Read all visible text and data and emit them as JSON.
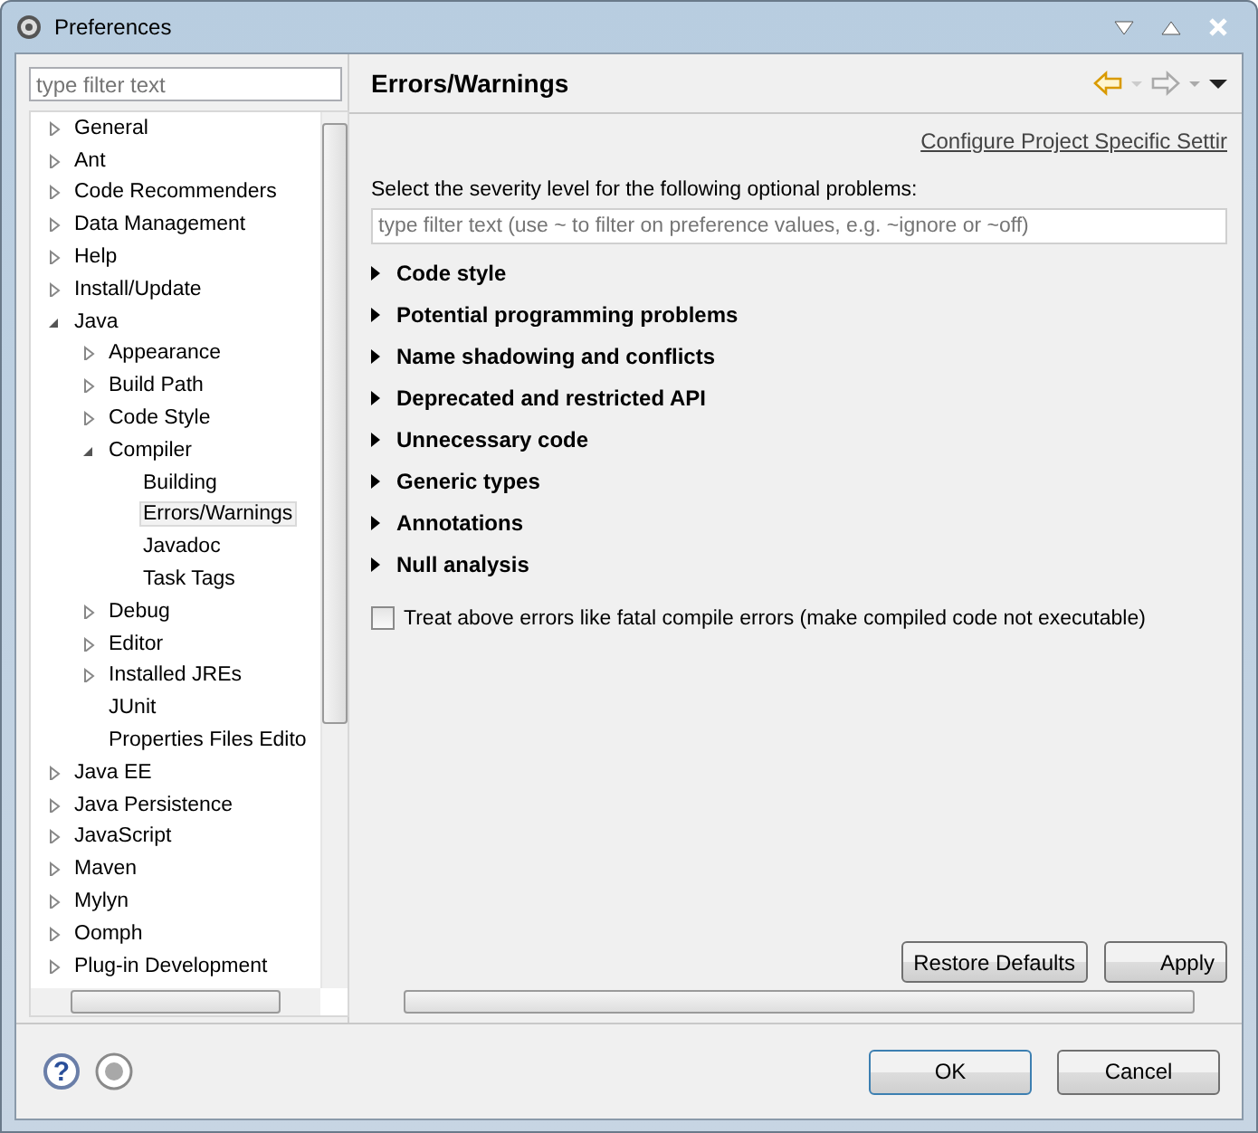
{
  "window": {
    "title": "Preferences"
  },
  "filter": {
    "placeholder": "type filter text"
  },
  "tree": [
    {
      "label": "General",
      "kind": "branch",
      "expanded": false,
      "selected": false
    },
    {
      "label": "Ant",
      "kind": "branch",
      "expanded": false,
      "selected": false
    },
    {
      "label": "Code Recommenders",
      "kind": "branch",
      "expanded": false,
      "selected": false
    },
    {
      "label": "Data Management",
      "kind": "branch",
      "expanded": false,
      "selected": false
    },
    {
      "label": "Help",
      "kind": "branch",
      "expanded": false,
      "selected": false
    },
    {
      "label": "Install/Update",
      "kind": "branch",
      "expanded": false,
      "selected": false
    },
    {
      "label": "Java",
      "kind": "branch",
      "expanded": true,
      "selected": false,
      "children": [
        {
          "label": "Appearance",
          "kind": "branch",
          "expanded": false,
          "selected": false
        },
        {
          "label": "Build Path",
          "kind": "branch",
          "expanded": false,
          "selected": false
        },
        {
          "label": "Code Style",
          "kind": "branch",
          "expanded": false,
          "selected": false
        },
        {
          "label": "Compiler",
          "kind": "branch",
          "expanded": true,
          "selected": false,
          "children": [
            {
              "label": "Building",
              "kind": "leaf",
              "selected": false
            },
            {
              "label": "Errors/Warnings",
              "kind": "leaf",
              "selected": true
            },
            {
              "label": "Javadoc",
              "kind": "leaf",
              "selected": false
            },
            {
              "label": "Task Tags",
              "kind": "leaf",
              "selected": false
            }
          ]
        },
        {
          "label": "Debug",
          "kind": "branch",
          "expanded": false,
          "selected": false
        },
        {
          "label": "Editor",
          "kind": "branch",
          "expanded": false,
          "selected": false
        },
        {
          "label": "Installed JREs",
          "kind": "branch",
          "expanded": false,
          "selected": false
        },
        {
          "label": "JUnit",
          "kind": "leaf",
          "selected": false
        },
        {
          "label": "Properties Files Edito",
          "kind": "leaf",
          "selected": false
        }
      ]
    },
    {
      "label": "Java EE",
      "kind": "branch",
      "expanded": false,
      "selected": false
    },
    {
      "label": "Java Persistence",
      "kind": "branch",
      "expanded": false,
      "selected": false
    },
    {
      "label": "JavaScript",
      "kind": "branch",
      "expanded": false,
      "selected": false
    },
    {
      "label": "Maven",
      "kind": "branch",
      "expanded": false,
      "selected": false
    },
    {
      "label": "Mylyn",
      "kind": "branch",
      "expanded": false,
      "selected": false
    },
    {
      "label": "Oomph",
      "kind": "branch",
      "expanded": false,
      "selected": false
    },
    {
      "label": "Plug-in Development",
      "kind": "branch",
      "expanded": false,
      "selected": false
    }
  ],
  "page": {
    "title": "Errors/Warnings",
    "link": "Configure Project Specific Settir",
    "description": "Select the severity level for the following optional problems:",
    "filter_placeholder": "type filter text (use ~ to filter on preference values, e.g. ~ignore or ~off)",
    "sections": [
      {
        "label": "Code style",
        "expanded": false
      },
      {
        "label": "Potential programming problems",
        "expanded": false
      },
      {
        "label": "Name shadowing and conflicts",
        "expanded": false
      },
      {
        "label": "Deprecated and restricted API",
        "expanded": false
      },
      {
        "label": "Unnecessary code",
        "expanded": false
      },
      {
        "label": "Generic types",
        "expanded": false
      },
      {
        "label": "Annotations",
        "expanded": false
      },
      {
        "label": "Null analysis",
        "expanded": false
      }
    ],
    "checkbox": {
      "label": "Treat above errors like fatal compile errors (make compiled code not executable)",
      "checked": false
    },
    "buttons": [
      "Restore Defaults",
      "Apply"
    ]
  },
  "help_glyph": "?",
  "buttons": [
    "OK",
    "Cancel"
  ]
}
